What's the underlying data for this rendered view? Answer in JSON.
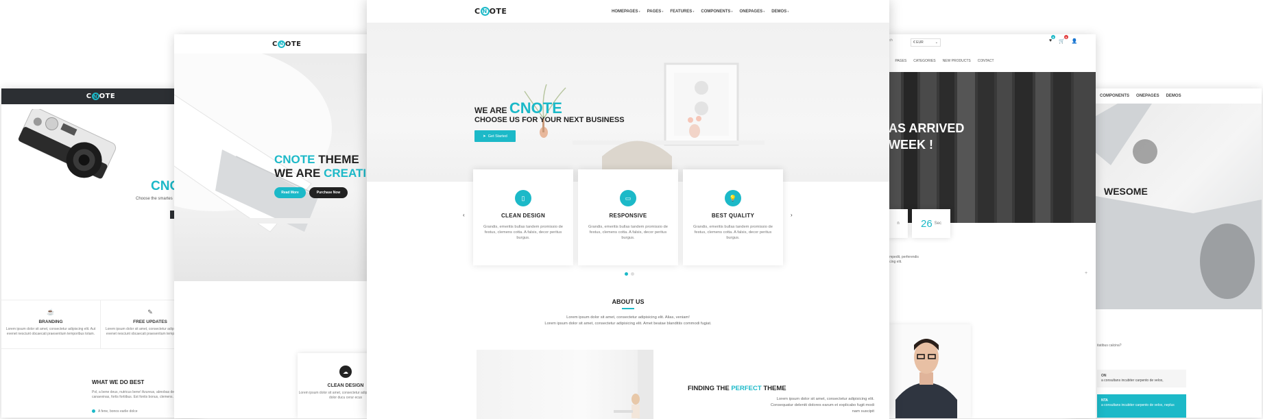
{
  "brand": {
    "logo_left": "C",
    "logo_o": "N",
    "logo_right": "OTE"
  },
  "colors": {
    "accent": "#1cb9c8",
    "dark": "#222222"
  },
  "card1": {
    "hero_title": "CNO",
    "hero_sub": "Choose the smartes",
    "features": [
      {
        "icon": "mug-icon",
        "title": "BRANDING",
        "text": "Lorem ipsum dolor sit amet, consectetur adipiscing elit. Aut evenet nesciunt obcaecati praesentium temporibus totam."
      },
      {
        "icon": "pencil-icon",
        "title": "FREE UPDATES",
        "text": "Lorem ipsum dolor sit amet, consectetur adipiscing elit. Aut evenet nesciunt obcaecati praesentium temporibus totam."
      }
    ],
    "wwd_title": "WHAT WE DO BEST",
    "wwd_text": "Pol, a bene deus, nutricus bene! Azureus, abnobas de canaevinas, fortis fortiibus. Est fontis bonus, clemens.",
    "wwd_item": "A fene, bonos earlie dolce"
  },
  "card2": {
    "hero_line1_a": "CNOTE",
    "hero_line1_b": " THEME",
    "hero_line2_a": "WE ARE ",
    "hero_line2_b": "CREATI",
    "btn_read": "Read More",
    "btn_purchase": "Purchase Now",
    "cd_title": "CLEAN DESIGN",
    "cd_text": "Lorem ipsum dolor sit amet, consectetur adipiscing elit. Anims dolor ducu cerur ecus"
  },
  "card3": {
    "nav": [
      "HOMEPAGES",
      "PAGES",
      "FEATURES",
      "COMPONENTS",
      "ONEPAGES",
      "DEMOS"
    ],
    "we_are": "WE ARE ",
    "we_brand": "CNOTE",
    "choose": "CHOOSE US FOR YOUR NEXT BUSINESS",
    "get_started": "Get Started",
    "features": [
      {
        "icon": "phone-icon",
        "title": "CLEAN DESIGN",
        "text": "Grandis, emeritis bullas tandem promissio de festus, clemens cotta. A falsis, decor peritus burgus."
      },
      {
        "icon": "monitor-icon",
        "title": "RESPONSIVE",
        "text": "Grandis, emeritis bullas tandem promissio de festus, clemens cotta. A falsis, decor peritus burgus."
      },
      {
        "icon": "bulb-icon",
        "title": "BEST QUALITY",
        "text": "Grandis, emeritis bullas tandem promissio de festus, clemens cotta. A falsis, decor peritus burgus."
      }
    ],
    "about_title": "ABOUT US",
    "about_line1": "Lorem ipsum dolor sit amet, consectetur adipisicing elit. Alias, veniam!",
    "about_line2": "Lorem ipsum dolor sit amet, consectetur adipisicing elit. Amet beatae blanditiis commodi fugiat.",
    "finding_a": "FINDING THE ",
    "finding_b": "PERFECT",
    "finding_c": " THEME",
    "finding_line1": "Lorem ipsum dolor sit amet, consectetur adipisicing elit.",
    "finding_line2": "Consequatur deleniti dolores earum et explicabo fugit modi",
    "finding_line3": "nam suscipit"
  },
  "card4": {
    "search": "arch",
    "currency": "€ EUR",
    "wish_count": "0",
    "cart_count": "0",
    "menu": [
      "E",
      "PAGES",
      "CATEGORIES",
      "NEW PRODUCTS",
      "CONTACT"
    ],
    "hero_line1": "AS ARRIVED",
    "hero_line2": "WEEK !",
    "cd_left": "n",
    "cd_num": "26",
    "cd_unit": "Sec",
    "ptext_1": "impedit, perferendis",
    "ptext_2": "icing elit."
  },
  "card5": {
    "nav": [
      "S",
      "COMPONENTS",
      "ONEPAGES",
      "DEMOS"
    ],
    "hero_title": "WESOME",
    "q": "itatibus calcina?",
    "acc1_title": "ON",
    "acc1_text": "a consultans incubiter carpento de velox, ",
    "acc2_title": "NTA",
    "acc2_text": "a consultans incubiter carpento de velox, neplus"
  }
}
